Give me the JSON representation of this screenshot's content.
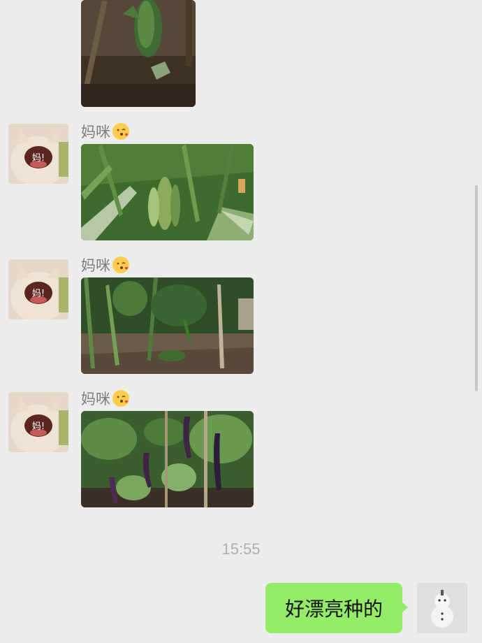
{
  "messages": [
    {
      "sender": "妈咪",
      "emoji": "kissing-face-emoji",
      "content_type": "image",
      "subject": "corn plants"
    },
    {
      "sender": "妈咪",
      "emoji": "kissing-face-emoji",
      "content_type": "image",
      "subject": "chili pepper plants"
    },
    {
      "sender": "妈咪",
      "emoji": "kissing-face-emoji",
      "content_type": "image",
      "subject": "eggplant plants"
    }
  ],
  "avatar_text": "妈!",
  "timestamp": "15:55",
  "my_message": "好漂亮种的",
  "colors": {
    "background": "#ededed",
    "outgoing_bubble": "#95ec69",
    "sender_name": "#7d7d7d",
    "timestamp": "#aeaeae"
  }
}
